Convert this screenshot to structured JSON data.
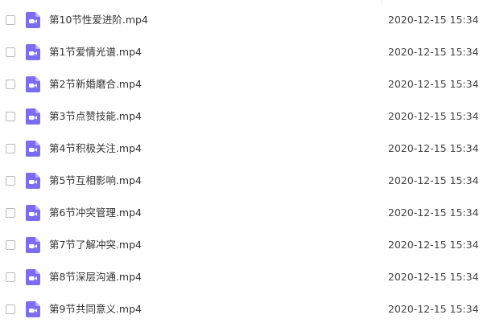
{
  "icon_color": "#7b6cf0",
  "files": [
    {
      "icon": "video-file-icon",
      "name": "第10节性爱进阶.mp4",
      "modified": "2020-12-15 15:34"
    },
    {
      "icon": "video-file-icon",
      "name": "第1节爱情光谱.mp4",
      "modified": "2020-12-15 15:34"
    },
    {
      "icon": "video-file-icon",
      "name": "第2节新婚磨合.mp4",
      "modified": "2020-12-15 15:34"
    },
    {
      "icon": "video-file-icon",
      "name": "第3节点赞技能.mp4",
      "modified": "2020-12-15 15:34"
    },
    {
      "icon": "video-file-icon",
      "name": "第4节积极关注.mp4",
      "modified": "2020-12-15 15:34"
    },
    {
      "icon": "video-file-icon",
      "name": "第5节互相影响.mp4",
      "modified": "2020-12-15 15:34"
    },
    {
      "icon": "video-file-icon",
      "name": "第6节冲突管理.mp4",
      "modified": "2020-12-15 15:34"
    },
    {
      "icon": "video-file-icon",
      "name": "第7节了解冲突.mp4",
      "modified": "2020-12-15 15:34"
    },
    {
      "icon": "video-file-icon",
      "name": "第8节深层沟通.mp4",
      "modified": "2020-12-15 15:34"
    },
    {
      "icon": "video-file-icon",
      "name": "第9节共同意义.mp4",
      "modified": "2020-12-15 15:34"
    }
  ]
}
